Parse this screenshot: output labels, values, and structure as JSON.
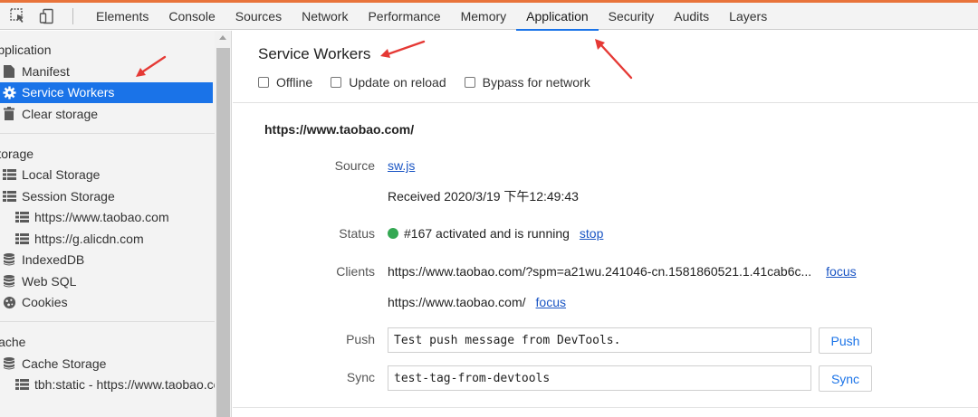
{
  "toolbar": {
    "tabs": [
      {
        "label": "Elements"
      },
      {
        "label": "Console"
      },
      {
        "label": "Sources"
      },
      {
        "label": "Network"
      },
      {
        "label": "Performance"
      },
      {
        "label": "Memory"
      },
      {
        "label": "Application",
        "active": true
      },
      {
        "label": "Security"
      },
      {
        "label": "Audits"
      },
      {
        "label": "Layers"
      }
    ]
  },
  "sidebar": {
    "application_section": "Application",
    "application_items": [
      {
        "label": "Manifest",
        "icon": "file-icon"
      },
      {
        "label": "Service Workers",
        "icon": "gear-icon",
        "selected": true
      },
      {
        "label": "Clear storage",
        "icon": "trash-icon"
      }
    ],
    "storage_section": "Storage",
    "storage_items": [
      {
        "label": "Local Storage",
        "icon": "grid-icon"
      },
      {
        "label": "Session Storage",
        "icon": "grid-icon"
      },
      {
        "label": "https://www.taobao.com",
        "icon": "grid-icon"
      },
      {
        "label": "https://g.alicdn.com",
        "icon": "grid-icon"
      },
      {
        "label": "IndexedDB",
        "icon": "database-icon"
      },
      {
        "label": "Web SQL",
        "icon": "database-icon"
      },
      {
        "label": "Cookies",
        "icon": "cookie-icon"
      }
    ],
    "cache_section": "Cache",
    "cache_items": [
      {
        "label": "Cache Storage",
        "icon": "database-icon"
      },
      {
        "label": "tbh:static - https://www.taobao.com",
        "icon": "grid-icon"
      }
    ]
  },
  "main": {
    "title": "Service Workers",
    "options": [
      "Offline",
      "Update on reload",
      "Bypass for network"
    ],
    "origin": "https://www.taobao.com/",
    "source_label": "Source",
    "source_value": "sw.js",
    "received": "Received 2020/3/19 下午12:49:43",
    "status_label": "Status",
    "status_value": "#167 activated and is running",
    "status_action": "stop",
    "clients_label": "Clients",
    "client1": "https://www.taobao.com/?spm=a21wu.241046-cn.1581860521.1.41cab6c...",
    "client2": "https://www.taobao.com/",
    "focus_label": "focus",
    "push_label": "Push",
    "push_value": "Test push message from DevTools.",
    "push_button": "Push",
    "sync_label": "Sync",
    "sync_value": "test-tag-from-devtools",
    "sync_button": "Sync"
  },
  "colors": {
    "accent": "#1a73e8",
    "link": "#1a55c4",
    "running_dot": "#34a853",
    "annotation_arrow": "#e53935"
  }
}
